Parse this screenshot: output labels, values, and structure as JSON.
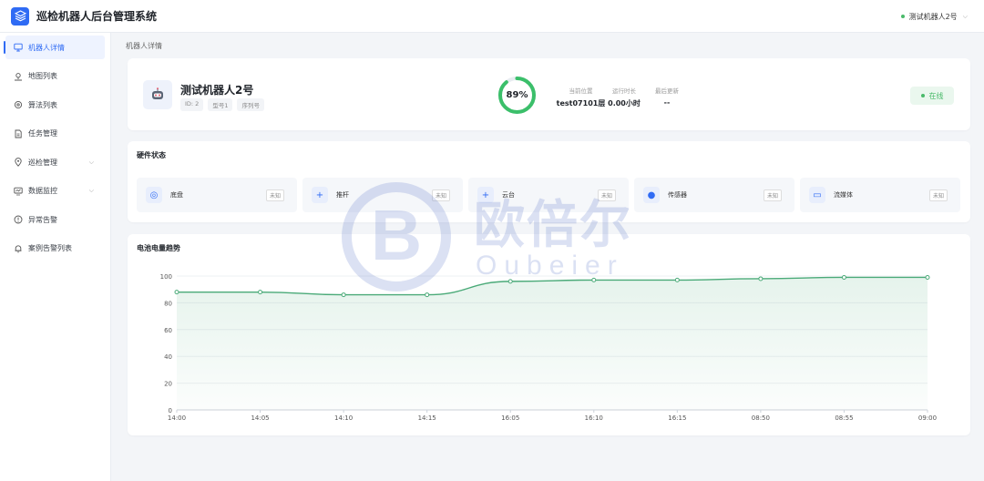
{
  "app": {
    "title": "巡检机器人后台管理系统"
  },
  "header": {
    "robot_selector": "测试机器人2号"
  },
  "sidebar": {
    "items": [
      {
        "label": "机器人详情",
        "icon": "monitor-icon",
        "active": true
      },
      {
        "label": "地图列表",
        "icon": "map-icon"
      },
      {
        "label": "算法列表",
        "icon": "settings-icon"
      },
      {
        "label": "任务管理",
        "icon": "document-icon"
      },
      {
        "label": "巡检管理",
        "icon": "location-icon",
        "expandable": true
      },
      {
        "label": "数据监控",
        "icon": "dashboard-icon",
        "expandable": true
      },
      {
        "label": "异常告警",
        "icon": "alert-icon"
      },
      {
        "label": "案例告警列表",
        "icon": "bell-icon"
      }
    ]
  },
  "breadcrumb": "机器人详情",
  "robot": {
    "name": "测试机器人2号",
    "id_tag": "ID: 2",
    "model_tag": "型号1",
    "serial_tag": "序列号",
    "battery_label": "89%",
    "battery_percent": 89,
    "stats": [
      {
        "label": "当前位置",
        "value": "test07101层"
      },
      {
        "label": "运行时长",
        "value": "0.00小时"
      },
      {
        "label": "最后更新",
        "value": "--"
      }
    ],
    "status": "在线",
    "status_color": "#4aba6a"
  },
  "hardware": {
    "title": "硬件状态",
    "items": [
      {
        "name": "底盘",
        "status": "未知",
        "icon": "chassis-icon"
      },
      {
        "name": "推杆",
        "status": "未知",
        "icon": "plus-icon"
      },
      {
        "name": "云台",
        "status": "未知",
        "icon": "plus-icon"
      },
      {
        "name": "传感器",
        "status": "未知",
        "icon": "sensor-icon"
      },
      {
        "name": "流媒体",
        "status": "未知",
        "icon": "video-icon"
      }
    ]
  },
  "chart_data": {
    "type": "area",
    "title": "电池电量趋势",
    "categories": [
      "14:00",
      "14:05",
      "14:10",
      "14:15",
      "16:05",
      "16:10",
      "16:15",
      "08:50",
      "08:55",
      "09:00"
    ],
    "values": [
      88,
      88,
      86,
      86,
      96,
      97,
      97,
      98,
      99,
      99
    ],
    "ylim": [
      0,
      100
    ],
    "yticks": [
      0,
      20,
      40,
      60,
      80,
      100
    ],
    "color": "#4aaa78",
    "grid": true
  },
  "watermark": {
    "cn": "欧倍尔",
    "en": "Oubeier",
    "mark": "B"
  },
  "colors": {
    "accent": "#2f6bf4",
    "online": "#4aba6a"
  }
}
